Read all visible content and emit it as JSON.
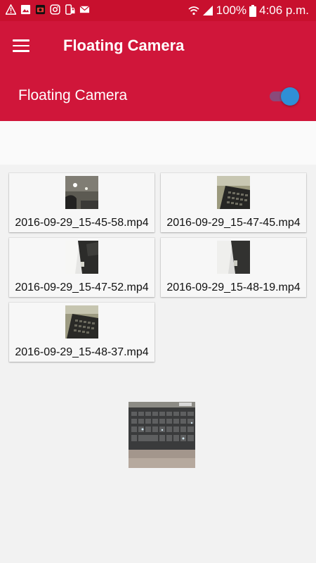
{
  "status_bar": {
    "battery": "100%",
    "time": "4:06 p.m.",
    "left_icons": [
      "warning-icon",
      "image-icon",
      "camera-icon",
      "instagram-icon",
      "phone-lock-icon",
      "mail-icon"
    ],
    "right_icons": [
      "wifi-icon",
      "signal-icon",
      "battery-icon"
    ]
  },
  "app_bar": {
    "menu_icon": "hamburger-menu-icon",
    "title": "Floating Camera"
  },
  "toggle": {
    "label": "Floating Camera",
    "state": "on",
    "thumb_color": "#2f8fd6"
  },
  "videos": [
    {
      "name": "2016-09-29_15-45-58.mp4"
    },
    {
      "name": "2016-09-29_15-47-45.mp4"
    },
    {
      "name": "2016-09-29_15-47-52.mp4"
    },
    {
      "name": "2016-09-29_15-48-19.mp4"
    },
    {
      "name": "2016-09-29_15-48-37.mp4"
    }
  ],
  "colors": {
    "status_bar": "#c8102e",
    "app_bar": "#d0163a",
    "background": "#f2f2f2"
  }
}
